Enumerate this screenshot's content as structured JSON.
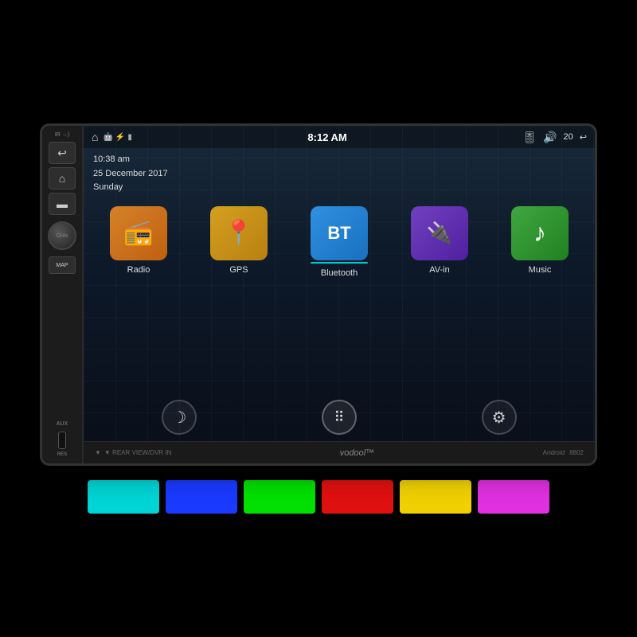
{
  "device": {
    "brand": "vodool™",
    "model": "8802",
    "platform": "Android",
    "bottom_label": "▼ REAR VIEW/DVR IN"
  },
  "status_bar": {
    "time": "8:12 AM",
    "volume": "20",
    "back_label": "↩"
  },
  "datetime": {
    "time": "10:38 am",
    "date": "25 December 2017",
    "day": "Sunday"
  },
  "apps": [
    {
      "id": "radio",
      "label": "Radio",
      "icon": "📻",
      "class": "app-radio"
    },
    {
      "id": "gps",
      "label": "GPS",
      "icon": "📍",
      "class": "app-gps"
    },
    {
      "id": "bluetooth",
      "label": "Bluetooth",
      "icon": "BT",
      "class": "app-bt",
      "active": true
    },
    {
      "id": "avin",
      "label": "AV-in",
      "icon": "🔌",
      "class": "app-avin"
    },
    {
      "id": "music",
      "label": "Music",
      "icon": "♪",
      "class": "app-music"
    }
  ],
  "bottom_nav": [
    {
      "id": "moon",
      "icon": "☽"
    },
    {
      "id": "grid",
      "icon": "⠿"
    },
    {
      "id": "settings",
      "icon": "⚙"
    }
  ],
  "side_buttons": [
    {
      "id": "back",
      "icon": "↩"
    },
    {
      "id": "home",
      "icon": "⌂"
    },
    {
      "id": "menu",
      "icon": "▬"
    }
  ],
  "side_labels": {
    "ir": "IR\n→)",
    "map": "MAP",
    "aux": "AUX",
    "res": "RES",
    "knob": "O/4x"
  },
  "color_swatches": [
    {
      "id": "cyan",
      "color": "#00d4d4"
    },
    {
      "id": "blue",
      "color": "#1a3aff"
    },
    {
      "id": "green",
      "color": "#00e000"
    },
    {
      "id": "red",
      "color": "#e01010"
    },
    {
      "id": "yellow",
      "color": "#f0d000"
    },
    {
      "id": "magenta",
      "color": "#e030e0"
    }
  ]
}
